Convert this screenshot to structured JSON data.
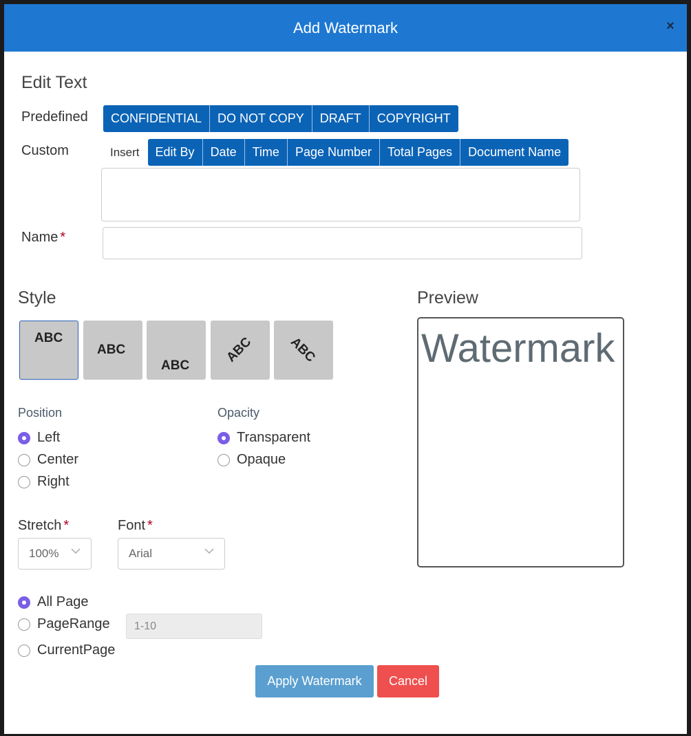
{
  "dialog": {
    "title": "Add Watermark",
    "close_label": "×"
  },
  "edit_text": {
    "heading": "Edit Text",
    "predefined_label": "Predefined",
    "predefined": [
      "CONFIDENTIAL",
      "DO NOT COPY",
      "DRAFT",
      "COPYRIGHT"
    ],
    "custom_label": "Custom",
    "insert_label": "Insert",
    "insert_tokens": [
      "Edit By",
      "Date",
      "Time",
      "Page Number",
      "Total Pages",
      "Document Name"
    ],
    "custom_text_value": "",
    "name_label": "Name",
    "name_required_mark": "*",
    "name_value": ""
  },
  "style": {
    "heading": "Style",
    "tiles": [
      {
        "text": "ABC",
        "selected": true
      },
      {
        "text": "ABC",
        "selected": false
      },
      {
        "text": "ABC",
        "selected": false
      },
      {
        "text": "ABC",
        "selected": false
      },
      {
        "text": "ABC",
        "selected": false
      }
    ]
  },
  "position": {
    "label": "Position",
    "options": [
      "Left",
      "Center",
      "Right"
    ],
    "selected": "Left"
  },
  "opacity": {
    "label": "Opacity",
    "options": [
      "Transparent",
      "Opaque"
    ],
    "selected": "Transparent"
  },
  "stretch": {
    "label": "Stretch",
    "required_mark": "*",
    "value": "100%"
  },
  "font": {
    "label": "Font",
    "required_mark": "*",
    "value": "Arial"
  },
  "pages": {
    "options": [
      "All Page",
      "PageRange",
      "CurrentPage"
    ],
    "selected": "All Page",
    "range_placeholder": "1-10"
  },
  "preview": {
    "heading": "Preview",
    "text": "Watermark"
  },
  "actions": {
    "apply_label": "Apply Watermark",
    "cancel_label": "Cancel"
  },
  "colors": {
    "title_bar": "#1e78d2",
    "button_bar": "#0b63b6",
    "radio_accent": "#7a5ee6",
    "apply": "#5a9fd0",
    "cancel": "#ef4f4f"
  }
}
